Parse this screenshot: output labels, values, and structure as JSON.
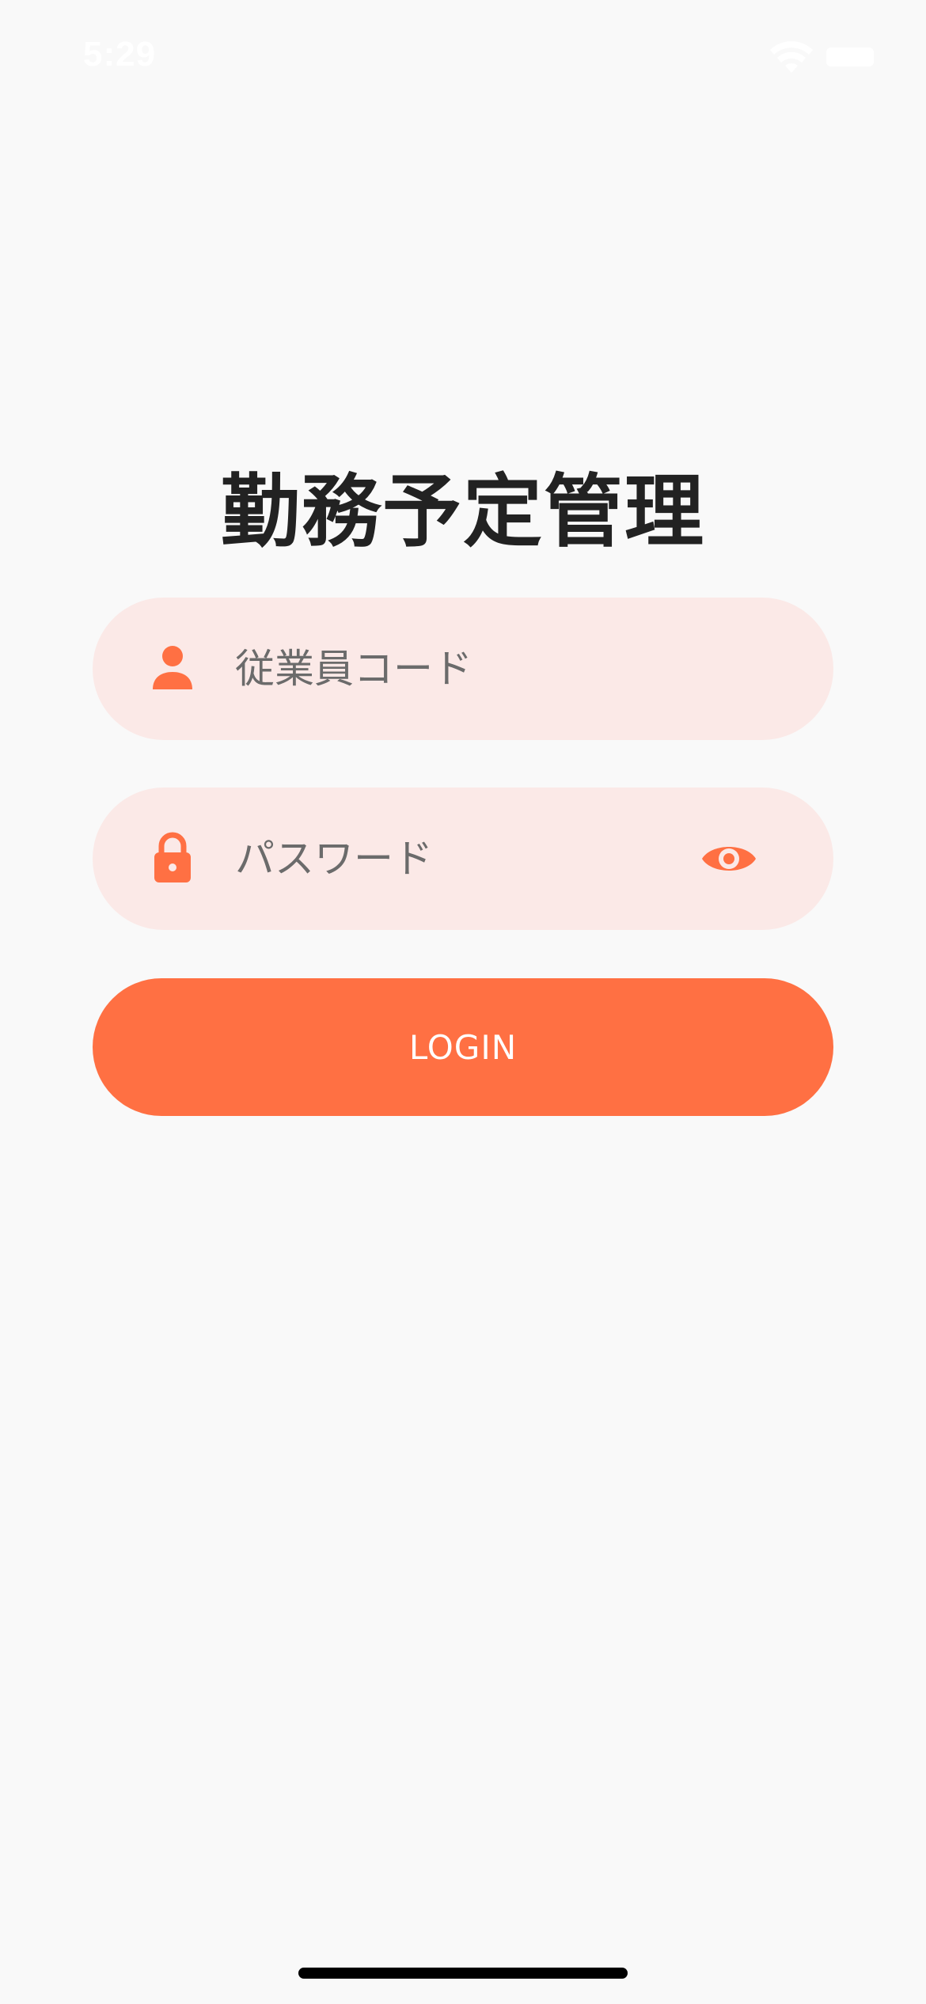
{
  "status_bar": {
    "time": "5:29",
    "wifi_icon": "wifi-icon",
    "battery_icon": "battery-icon"
  },
  "app": {
    "title": "勤務予定管理"
  },
  "login_form": {
    "employee_code": {
      "icon": "person-icon",
      "value": "",
      "placeholder": "従業員コード"
    },
    "password": {
      "icon": "lock-icon",
      "value": "",
      "placeholder": "パスワード",
      "visibility_toggle_icon": "eye-icon"
    },
    "login_button_label": "LOGIN"
  },
  "colors": {
    "accent": "#ff7043",
    "field_background": "#fbe9e7",
    "page_background": "#f9f9f9",
    "title_text": "#222222",
    "placeholder_text": "#6b6b6b"
  }
}
